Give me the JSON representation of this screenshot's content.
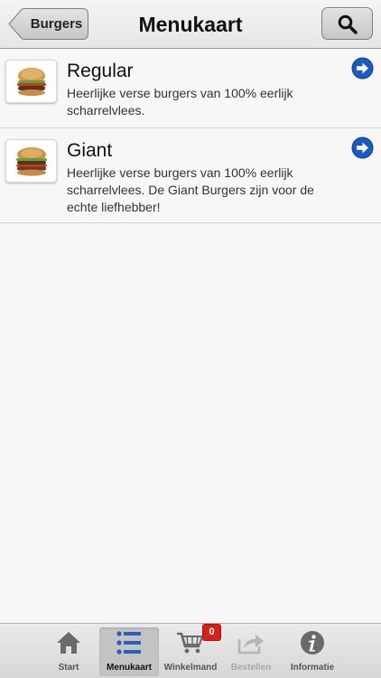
{
  "navbar": {
    "back_label": "Burgers",
    "title": "Menukaart",
    "search_icon": "search-icon"
  },
  "items": [
    {
      "title": "Regular",
      "description": "Heerlijke verse burgers van 100% eerlijk scharrelvlees.",
      "image": "burger-icon",
      "arrow_icon": "arrow-right-circle-icon"
    },
    {
      "title": "Giant",
      "description": "Heerlijke verse burgers van 100% eerlijk scharrelvlees. De Giant Burgers zijn voor de echte liefhebber!",
      "image": "burger-icon",
      "arrow_icon": "arrow-right-circle-icon"
    }
  ],
  "tabbar": {
    "tabs": [
      {
        "label": "Start",
        "icon": "home-icon",
        "state": "normal"
      },
      {
        "label": "Menukaart",
        "icon": "list-icon",
        "state": "active"
      },
      {
        "label": "Winkelmand",
        "icon": "cart-icon",
        "state": "normal"
      },
      {
        "label": "Bestellen",
        "icon": "share-icon",
        "state": "disabled"
      },
      {
        "label": "Informatie",
        "icon": "info-icon",
        "state": "normal"
      }
    ],
    "cart_badge": "0"
  },
  "colors": {
    "accent_blue": "#1a5bbf",
    "badge_red": "#d6201c",
    "list_icon_blue": "#2b5fb8"
  }
}
